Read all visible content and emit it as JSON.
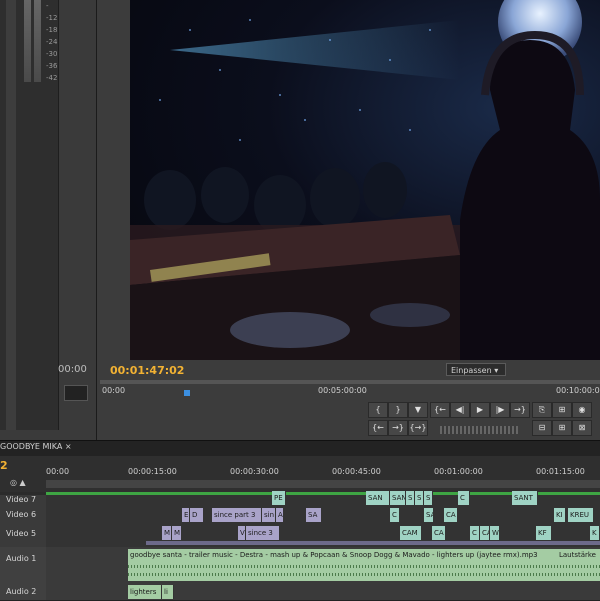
{
  "left_panel": {
    "timecode": "00:00",
    "meter_ticks": [
      "-",
      "-12",
      "-18",
      "-24",
      "-30",
      "-36",
      "-42"
    ]
  },
  "monitor": {
    "current_timecode": "00:01:47:02",
    "fit_label": "Einpassen",
    "ruler": [
      "00:00",
      "00:05:00:00",
      "00:10:00:00"
    ],
    "transport_row1": [
      "{",
      "}",
      "▼",
      "{←",
      "◀|",
      "▶",
      "|▶",
      "→}",
      "⎘",
      "⊞",
      "◉"
    ],
    "transport_row2": [
      "{←",
      "→}",
      "{→}",
      "⊟",
      "⊞",
      "⊠"
    ]
  },
  "sequence": {
    "tab_label": "GOODBYE MIKA",
    "timecode": "2",
    "ruler": [
      "00:00",
      "00:00:15:00",
      "00:00:30:00",
      "00:00:45:00",
      "00:01:00:00",
      "00:01:15:00"
    ]
  },
  "tracks": {
    "video7": {
      "name": "Video 7",
      "clips": [
        "PE",
        "SAN",
        "SAN",
        "S",
        "S",
        "S",
        "C",
        "SANT"
      ]
    },
    "video6": {
      "name": "Video 6",
      "clips": [
        "E",
        "D",
        "since part 3",
        "sin",
        "A",
        "SA",
        "C",
        "SA",
        "CA",
        "KI",
        "KREU"
      ]
    },
    "video5": {
      "name": "Video 5",
      "clips": [
        "M",
        "M",
        "V",
        "since 3",
        "CAM",
        "CA",
        "C",
        "CA",
        "W",
        "KF",
        "K"
      ]
    },
    "audio1": {
      "name": "Audio 1",
      "clip": "goodbye santa - trailer music - Destra - mash up & Popcaan & Snoop Dogg & Mavado - lighters up (jaytee rmx).mp3",
      "fx": "Lautstärke"
    },
    "audio2": {
      "name": "Audio 2",
      "clips": [
        "lighters",
        "li"
      ]
    }
  }
}
